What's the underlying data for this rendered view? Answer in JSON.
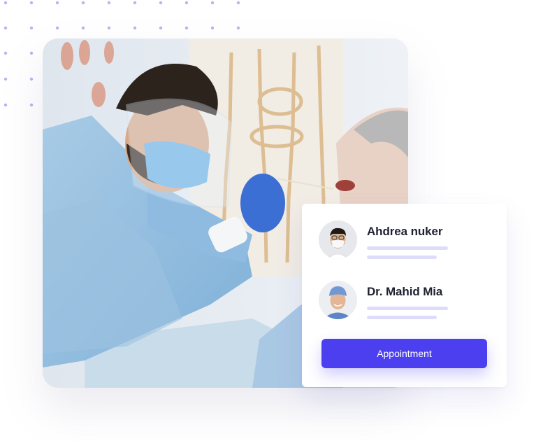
{
  "doctors": [
    {
      "name": "Ahdrea nuker",
      "avatar_icon": "masked-doctor-avatar-icon"
    },
    {
      "name": "Dr. Mahid Mia",
      "avatar_icon": "surgeon-avatar-icon"
    }
  ],
  "appointment_button": {
    "label": "Appointment"
  },
  "colors": {
    "accent": "#4b3ff0",
    "placeholder_bar": "#dedcfb",
    "dots": "#b9b2f5"
  }
}
